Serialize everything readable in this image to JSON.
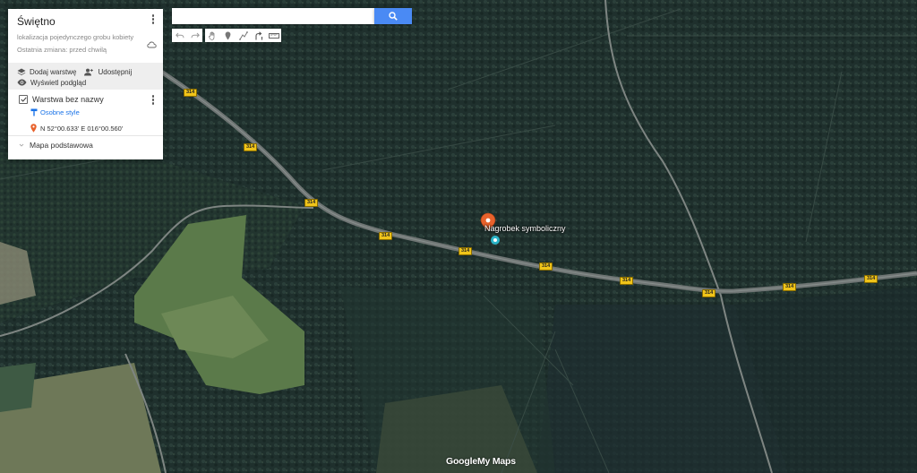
{
  "map": {
    "title": "Świętno",
    "description": "lokalizacja pojedynczego grobu kobiety",
    "last_modified": "Ostatnia zmiana: przed chwilą",
    "add_layer_label": "Dodaj warstwę",
    "share_label": "Udostępnij",
    "preview_label": "Wyświetl podgląd",
    "layer": {
      "name": "Warstwa bez nazwy",
      "checked": true,
      "style_label": "Osobne style",
      "place_label": "N 52°00.633' E 016°00.560'"
    },
    "base_map_label": "Mapa podstawowa"
  },
  "search": {
    "value": "",
    "placeholder": ""
  },
  "toolbar": {
    "icons": [
      "undo-icon",
      "redo-icon",
      "hand-icon",
      "marker-icon",
      "draw-line-icon",
      "directions-icon",
      "ruler-icon"
    ]
  },
  "marker": {
    "label": "Nagrobek symboliczny",
    "color": "#e8622c"
  },
  "road_shields": [
    {
      "text": "314"
    },
    {
      "text": "314"
    },
    {
      "text": "314"
    },
    {
      "text": "314"
    },
    {
      "text": "314"
    },
    {
      "text": "314"
    },
    {
      "text": "314"
    },
    {
      "text": "314"
    },
    {
      "text": "314"
    }
  ],
  "footer": {
    "logo_google": "Google",
    "logo_mymaps": "My Maps"
  },
  "colors": {
    "accent": "#4a8af4",
    "link": "#1a73e8",
    "road_shield": "#f0c419"
  }
}
